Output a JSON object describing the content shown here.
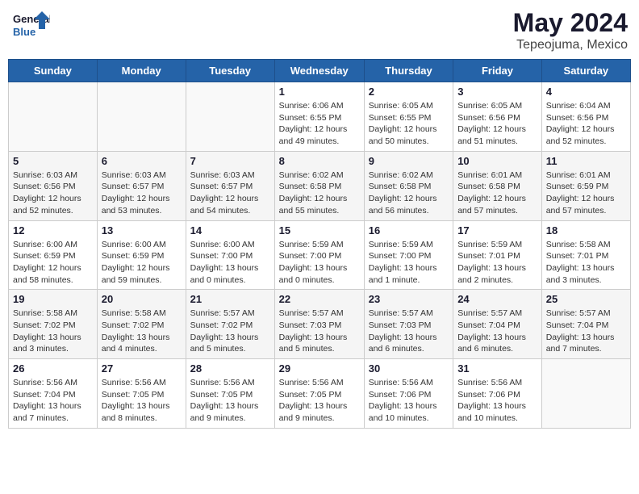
{
  "logo": {
    "line1": "General",
    "line2": "Blue"
  },
  "title": "May 2024",
  "location": "Tepeojuma, Mexico",
  "weekdays": [
    "Sunday",
    "Monday",
    "Tuesday",
    "Wednesday",
    "Thursday",
    "Friday",
    "Saturday"
  ],
  "weeks": [
    [
      {
        "day": "",
        "info": ""
      },
      {
        "day": "",
        "info": ""
      },
      {
        "day": "",
        "info": ""
      },
      {
        "day": "1",
        "info": "Sunrise: 6:06 AM\nSunset: 6:55 PM\nDaylight: 12 hours\nand 49 minutes."
      },
      {
        "day": "2",
        "info": "Sunrise: 6:05 AM\nSunset: 6:55 PM\nDaylight: 12 hours\nand 50 minutes."
      },
      {
        "day": "3",
        "info": "Sunrise: 6:05 AM\nSunset: 6:56 PM\nDaylight: 12 hours\nand 51 minutes."
      },
      {
        "day": "4",
        "info": "Sunrise: 6:04 AM\nSunset: 6:56 PM\nDaylight: 12 hours\nand 52 minutes."
      }
    ],
    [
      {
        "day": "5",
        "info": "Sunrise: 6:03 AM\nSunset: 6:56 PM\nDaylight: 12 hours\nand 52 minutes."
      },
      {
        "day": "6",
        "info": "Sunrise: 6:03 AM\nSunset: 6:57 PM\nDaylight: 12 hours\nand 53 minutes."
      },
      {
        "day": "7",
        "info": "Sunrise: 6:03 AM\nSunset: 6:57 PM\nDaylight: 12 hours\nand 54 minutes."
      },
      {
        "day": "8",
        "info": "Sunrise: 6:02 AM\nSunset: 6:58 PM\nDaylight: 12 hours\nand 55 minutes."
      },
      {
        "day": "9",
        "info": "Sunrise: 6:02 AM\nSunset: 6:58 PM\nDaylight: 12 hours\nand 56 minutes."
      },
      {
        "day": "10",
        "info": "Sunrise: 6:01 AM\nSunset: 6:58 PM\nDaylight: 12 hours\nand 57 minutes."
      },
      {
        "day": "11",
        "info": "Sunrise: 6:01 AM\nSunset: 6:59 PM\nDaylight: 12 hours\nand 57 minutes."
      }
    ],
    [
      {
        "day": "12",
        "info": "Sunrise: 6:00 AM\nSunset: 6:59 PM\nDaylight: 12 hours\nand 58 minutes."
      },
      {
        "day": "13",
        "info": "Sunrise: 6:00 AM\nSunset: 6:59 PM\nDaylight: 12 hours\nand 59 minutes."
      },
      {
        "day": "14",
        "info": "Sunrise: 6:00 AM\nSunset: 7:00 PM\nDaylight: 13 hours\nand 0 minutes."
      },
      {
        "day": "15",
        "info": "Sunrise: 5:59 AM\nSunset: 7:00 PM\nDaylight: 13 hours\nand 0 minutes."
      },
      {
        "day": "16",
        "info": "Sunrise: 5:59 AM\nSunset: 7:00 PM\nDaylight: 13 hours\nand 1 minute."
      },
      {
        "day": "17",
        "info": "Sunrise: 5:59 AM\nSunset: 7:01 PM\nDaylight: 13 hours\nand 2 minutes."
      },
      {
        "day": "18",
        "info": "Sunrise: 5:58 AM\nSunset: 7:01 PM\nDaylight: 13 hours\nand 3 minutes."
      }
    ],
    [
      {
        "day": "19",
        "info": "Sunrise: 5:58 AM\nSunset: 7:02 PM\nDaylight: 13 hours\nand 3 minutes."
      },
      {
        "day": "20",
        "info": "Sunrise: 5:58 AM\nSunset: 7:02 PM\nDaylight: 13 hours\nand 4 minutes."
      },
      {
        "day": "21",
        "info": "Sunrise: 5:57 AM\nSunset: 7:02 PM\nDaylight: 13 hours\nand 5 minutes."
      },
      {
        "day": "22",
        "info": "Sunrise: 5:57 AM\nSunset: 7:03 PM\nDaylight: 13 hours\nand 5 minutes."
      },
      {
        "day": "23",
        "info": "Sunrise: 5:57 AM\nSunset: 7:03 PM\nDaylight: 13 hours\nand 6 minutes."
      },
      {
        "day": "24",
        "info": "Sunrise: 5:57 AM\nSunset: 7:04 PM\nDaylight: 13 hours\nand 6 minutes."
      },
      {
        "day": "25",
        "info": "Sunrise: 5:57 AM\nSunset: 7:04 PM\nDaylight: 13 hours\nand 7 minutes."
      }
    ],
    [
      {
        "day": "26",
        "info": "Sunrise: 5:56 AM\nSunset: 7:04 PM\nDaylight: 13 hours\nand 7 minutes."
      },
      {
        "day": "27",
        "info": "Sunrise: 5:56 AM\nSunset: 7:05 PM\nDaylight: 13 hours\nand 8 minutes."
      },
      {
        "day": "28",
        "info": "Sunrise: 5:56 AM\nSunset: 7:05 PM\nDaylight: 13 hours\nand 9 minutes."
      },
      {
        "day": "29",
        "info": "Sunrise: 5:56 AM\nSunset: 7:05 PM\nDaylight: 13 hours\nand 9 minutes."
      },
      {
        "day": "30",
        "info": "Sunrise: 5:56 AM\nSunset: 7:06 PM\nDaylight: 13 hours\nand 10 minutes."
      },
      {
        "day": "31",
        "info": "Sunrise: 5:56 AM\nSunset: 7:06 PM\nDaylight: 13 hours\nand 10 minutes."
      },
      {
        "day": "",
        "info": ""
      }
    ]
  ]
}
